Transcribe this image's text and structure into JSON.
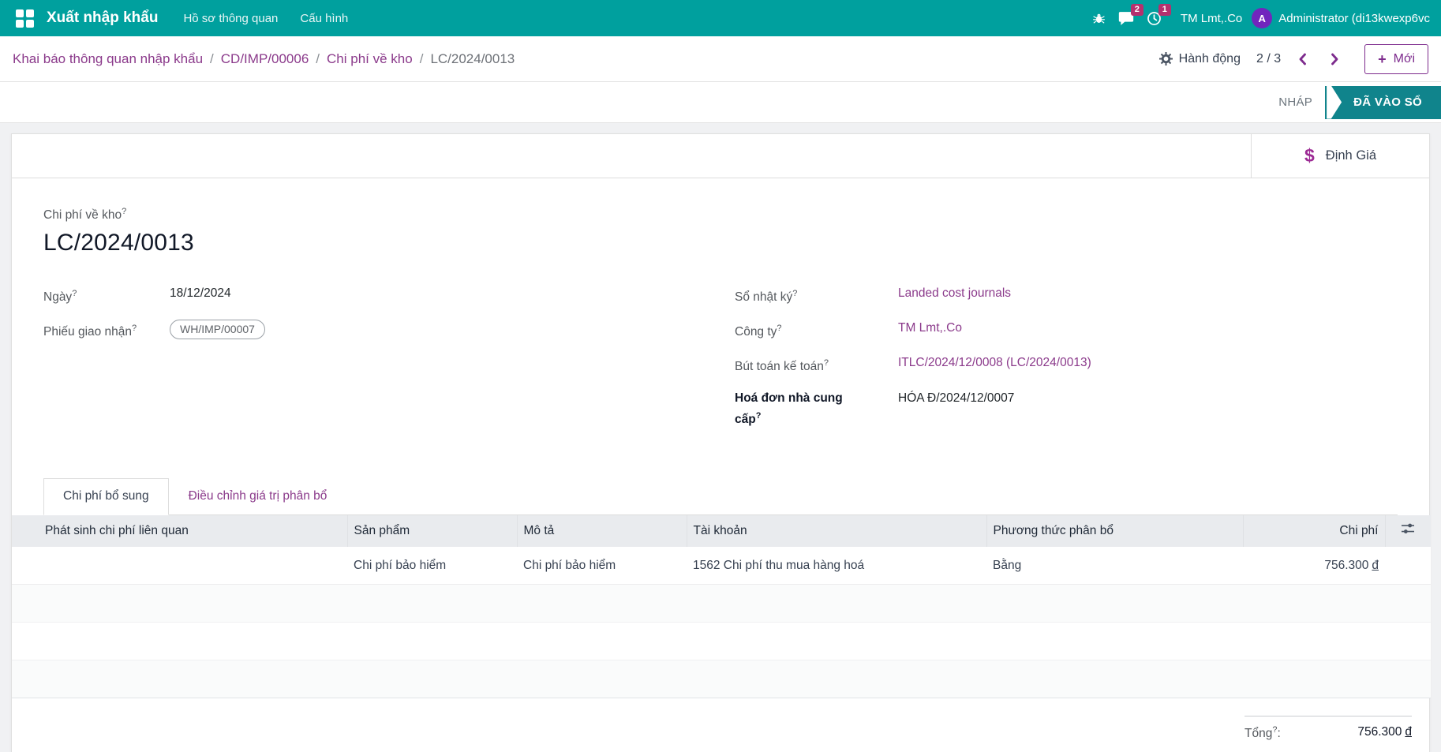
{
  "colors": {
    "topbar_teal": "#00a09e",
    "stage_teal": "#10848c",
    "accent_purple": "#8b3a8b",
    "badge_magenta": "#b5306e",
    "avatar_purple": "#7126bd"
  },
  "topbar": {
    "app_name": "Xuất nhập khẩu",
    "menus": [
      "Hồ sơ thông quan",
      "Cấu hình"
    ],
    "messages_badge": "2",
    "activities_badge": "1",
    "company": "TM Lmt,.Co",
    "avatar_letter": "A",
    "user": "Administrator (di13kwexp6vc"
  },
  "breadcrumb": {
    "items": [
      "Khai báo thông quan nhập khẩu",
      "CD/IMP/00006",
      "Chi phí về kho"
    ],
    "separator": "/",
    "current": "LC/2024/0013"
  },
  "control_panel": {
    "action_label": "Hành động",
    "pager": "2 / 3",
    "new_icon": "+",
    "new_label": "Mới"
  },
  "statusbar": {
    "stages": [
      {
        "label": "NHÁP"
      },
      {
        "label": "ĐÃ VÀO SỔ"
      }
    ]
  },
  "button_box": {
    "icon": "$",
    "valuation_label": "Định Giá"
  },
  "form": {
    "help_mark": "?",
    "title_label": "Chi phí về kho",
    "title": "LC/2024/0013",
    "date_label": "Ngày",
    "date_value": "18/12/2024",
    "picking_label": "Phiếu giao nhận",
    "picking_value": "WH/IMP/00007",
    "journal_label": "Sổ nhật ký",
    "journal_value": "Landed cost journals",
    "company_label": "Công ty",
    "company_value": "TM Lmt,.Co",
    "move_label": "Bút toán kế toán",
    "move_value": "ITLC/2024/12/0008 (LC/2024/0013)",
    "bill_label": "Hoá đơn nhà cung cấp",
    "bill_value": "HÓA Đ/2024/12/0007"
  },
  "tabs": {
    "costs": "Chi phí bổ sung",
    "adjustments": "Điều chỉnh giá trị phân bổ"
  },
  "table": {
    "columns": [
      "Phát sinh chi phí liên quan",
      "Sản phẩm",
      "Mô tả",
      "Tài khoản",
      "Phương thức phân bổ",
      "Chi phí"
    ],
    "rows": [
      {
        "related": "",
        "product": "Chi phí bảo hiểm",
        "description": "Chi phí bảo hiểm",
        "account": "1562 Chi phí thu mua hàng hoá",
        "split_method": "Bằng",
        "cost": "756.300",
        "currency": "đ"
      }
    ],
    "total_label": "Tổng",
    "total_colon": ":",
    "total_value": "756.300",
    "total_currency": "đ"
  }
}
